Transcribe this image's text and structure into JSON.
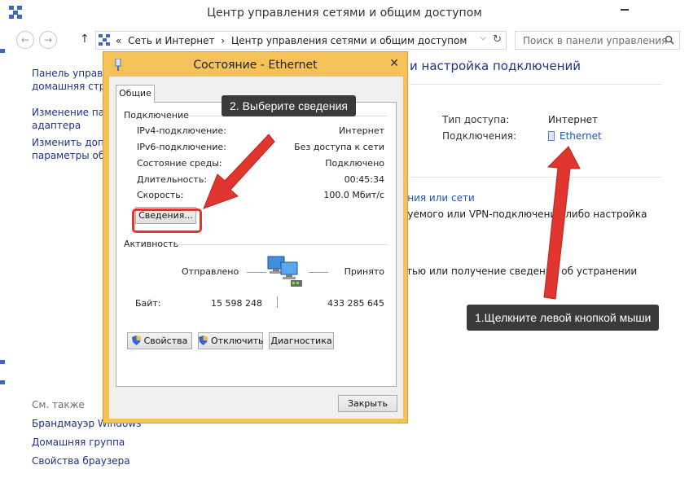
{
  "window": {
    "title": "Центр управления сетями и общим доступом"
  },
  "nav": {
    "back_glyph": "←",
    "forward_glyph": "→",
    "up_glyph": "↑",
    "address_prefix": "«",
    "breadcrumbs": [
      "Сеть и Интернет",
      "›",
      "Центр управления сетями и общим доступом"
    ],
    "address_first_sep": "›",
    "dropdown_glyph": "⌵",
    "refresh_glyph": "↻",
    "search_placeholder": "Поиск в панели управления"
  },
  "sidebar": {
    "items": [
      {
        "line1": "Панель управле",
        "line2": "домашняя стран"
      },
      {
        "line1": "Изменение пара",
        "line2": "адаптера"
      },
      {
        "line1": "Изменить допол",
        "line2": "параметры общ"
      }
    ],
    "see_also_label": "См. также",
    "see_also": [
      "Брандмауэр Windows",
      "Домашняя группа",
      "Свойства браузера"
    ]
  },
  "main": {
    "heading": "и настройка подключений",
    "access_type_label": "Тип доступа:",
    "access_type_value": "Интернет",
    "connections_label": "Подключения:",
    "connection_name": "Ethernet",
    "line1": "нения или сети",
    "line2": "ируемого или VPN-подключения либо настройка",
    "line3": "сетью или получение сведений об устранении"
  },
  "dialog": {
    "title": "Состояние - Ethernet",
    "close_glyph": "✕",
    "tab_general": "Общие",
    "connection_group": "Подключение",
    "rows": [
      {
        "label": "IPv4-подключение:",
        "value": "Интернет"
      },
      {
        "label": "IPv6-подключение:",
        "value": "Без доступа к сети"
      },
      {
        "label": "Состояние среды:",
        "value": "Подключено"
      },
      {
        "label": "Длительность:",
        "value": "00:45:34"
      },
      {
        "label": "Скорость:",
        "value": "100.0 Мбит/с"
      }
    ],
    "details_button": "Сведения...",
    "activity_group": "Активность",
    "sent_label": "Отправлено",
    "received_label": "Принято",
    "bytes_label": "Байт:",
    "bytes_sent": "15 598 248",
    "bytes_received": "433 285 645",
    "properties_button": "Свойства",
    "disable_button": "Отключить",
    "diagnose_button": "Диагностика",
    "close_button": "Закрыть"
  },
  "annotations": {
    "step2": "2. Выберите сведения",
    "step1": "1.Щелкните левой кнопкой мыши",
    "arrow_color": "#e0362f",
    "callout_color": "#3a3a3a"
  }
}
